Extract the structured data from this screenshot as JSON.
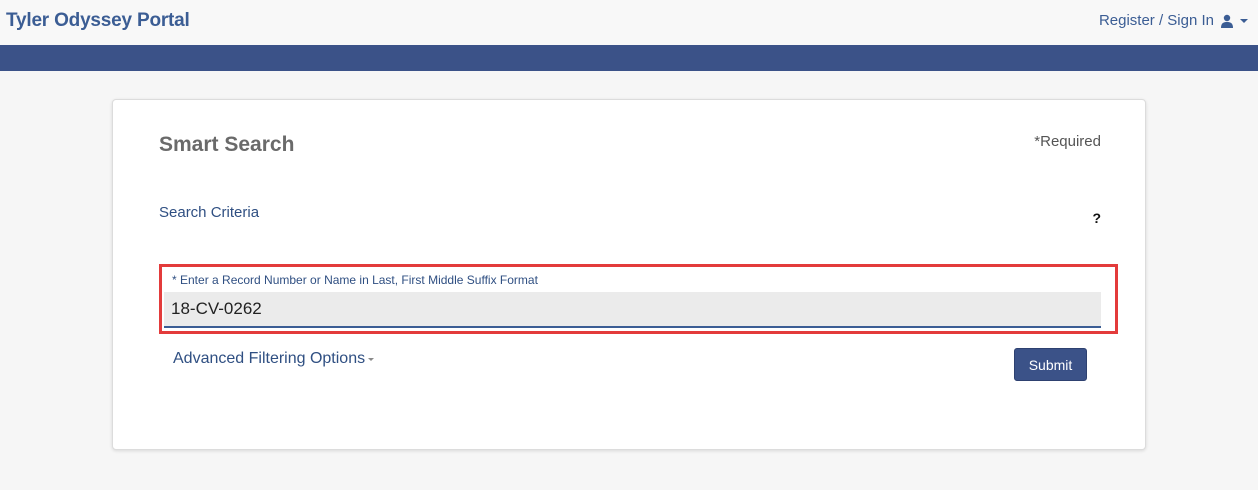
{
  "header": {
    "brand": "Tyler Odyssey Portal",
    "signin_label": "Register / Sign In",
    "user_icon": "user-icon",
    "caret_icon": "caret-down-icon"
  },
  "colors": {
    "brand": "#3b5d94",
    "nav_bar": "#3b5288",
    "highlight_border": "#e33b3b",
    "submit_bg": "#3b5288"
  },
  "search": {
    "title": "Smart Search",
    "required_note": "*Required",
    "criteria_heading": "Search Criteria",
    "help_label": "?",
    "field_label": "* Enter a Record Number or Name in Last, First Middle Suffix Format",
    "value": "18-CV-0262",
    "advanced_label": "Advanced Filtering Options",
    "submit_label": "Submit"
  }
}
